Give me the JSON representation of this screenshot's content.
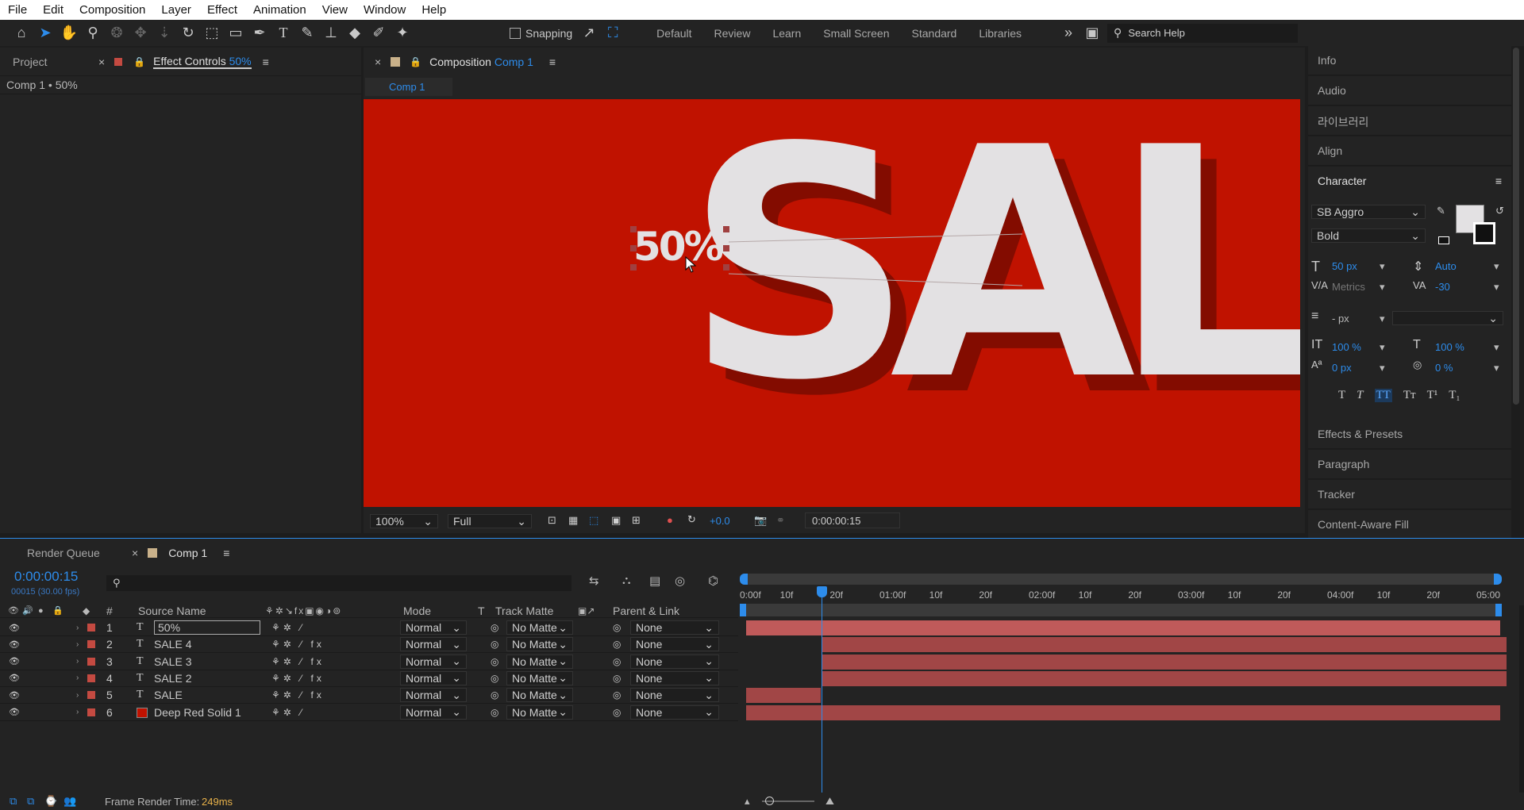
{
  "menu": [
    "File",
    "Edit",
    "Composition",
    "Layer",
    "Effect",
    "Animation",
    "View",
    "Window",
    "Help"
  ],
  "toolbar": {
    "snapping": "Snapping",
    "workspaces": [
      "Default",
      "Review",
      "Learn",
      "Small Screen",
      "Standard",
      "Libraries"
    ],
    "search_placeholder": "Search Help"
  },
  "left_panel": {
    "tab_project": "Project",
    "tab_effect_controls": "Effect Controls",
    "effect_layer": "50%",
    "breadcrumb": "Comp 1 • 50%"
  },
  "comp_panel": {
    "tab_label": "Composition",
    "comp_name": "Comp 1",
    "sub_tab": "Comp 1",
    "canvas_text": "SALE",
    "small_text": "50%",
    "zoom": "100%",
    "resolution": "Full",
    "exposure": "+0.0",
    "timecode": "0:00:00:15",
    "bg_color": "#c01200",
    "text_color": "#e3e1e3"
  },
  "right_panel": {
    "items": [
      "Info",
      "Audio",
      "라이브러리",
      "Align"
    ],
    "character": {
      "title": "Character",
      "font": "SB Aggro",
      "style": "Bold",
      "size": "50 px",
      "leading": "Auto",
      "kerning": "Metrics",
      "tracking": "-30",
      "stroke": "- px",
      "vscale": "100 %",
      "hscale": "100 %",
      "baseline": "0 px",
      "tsume": "0 %"
    },
    "items_bottom": [
      "Effects & Presets",
      "Paragraph",
      "Tracker",
      "Content-Aware Fill"
    ]
  },
  "timeline": {
    "tab_render_queue": "Render Queue",
    "tab_comp": "Comp 1",
    "timecode": "0:00:00:15",
    "fps": "00015 (30.00 fps)",
    "headers": {
      "source": "Source Name",
      "mode": "Mode",
      "t": "T",
      "track_matte": "Track Matte",
      "parent": "Parent & Link",
      "num": "#"
    },
    "ruler": [
      "0:00f",
      "10f",
      "20f",
      "01:00f",
      "10f",
      "20f",
      "02:00f",
      "10f",
      "20f",
      "03:00f",
      "10f",
      "20f",
      "04:00f",
      "10f",
      "20f",
      "05:00"
    ],
    "layers": [
      {
        "num": "1",
        "type": "T",
        "name": "50%",
        "mode": "Normal",
        "matte": "No Matte",
        "parent": "None"
      },
      {
        "num": "2",
        "type": "T",
        "name": "SALE 4",
        "mode": "Normal",
        "matte": "No Matte",
        "parent": "None"
      },
      {
        "num": "3",
        "type": "T",
        "name": "SALE 3",
        "mode": "Normal",
        "matte": "No Matte",
        "parent": "None"
      },
      {
        "num": "4",
        "type": "T",
        "name": "SALE 2",
        "mode": "Normal",
        "matte": "No Matte",
        "parent": "None"
      },
      {
        "num": "5",
        "type": "T",
        "name": "SALE",
        "mode": "Normal",
        "matte": "No Matte",
        "parent": "None"
      },
      {
        "num": "6",
        "type": "",
        "name": "Deep Red Solid 1",
        "mode": "Normal",
        "matte": "No Matte",
        "parent": "None"
      }
    ],
    "render_label": "Frame Render Time:",
    "render_time": "249ms"
  }
}
